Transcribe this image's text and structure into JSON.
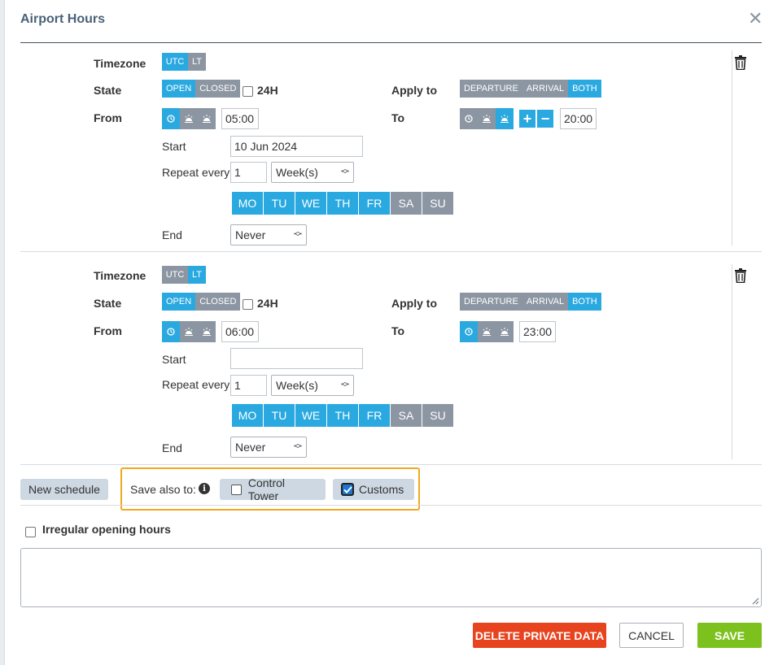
{
  "dialog": {
    "title": "Airport Hours",
    "close_label": "✕"
  },
  "schedules": [
    {
      "timezone_label": "Timezone",
      "tz_options": [
        "UTC",
        "LT"
      ],
      "tz_selected": "UTC",
      "state_label": "State",
      "state_options": [
        "OPEN",
        "CLOSED"
      ],
      "state_selected": "OPEN",
      "h24_label": "24H",
      "apply_label": "Apply to",
      "apply_options": [
        "DEPARTURE",
        "ARRIVAL",
        "BOTH"
      ],
      "apply_selected": "BOTH",
      "from_label": "From",
      "from_time": "05:00",
      "to_label": "To",
      "to_time": "20:00",
      "start_label": "Start",
      "start_value": "10 Jun 2024",
      "repeat_label": "Repeat every",
      "repeat_value": "1",
      "repeat_unit": "Week(s)",
      "days": [
        "MO",
        "TU",
        "WE",
        "TH",
        "FR",
        "SA",
        "SU"
      ],
      "end_label": "End",
      "end_value": "Never"
    },
    {
      "timezone_label": "Timezone",
      "tz_options": [
        "UTC",
        "LT"
      ],
      "tz_selected": "LT",
      "state_label": "State",
      "state_options": [
        "OPEN",
        "CLOSED"
      ],
      "state_selected": "OPEN",
      "h24_label": "24H",
      "apply_label": "Apply to",
      "apply_options": [
        "DEPARTURE",
        "ARRIVAL",
        "BOTH"
      ],
      "apply_selected": "BOTH",
      "from_label": "From",
      "from_time": "06:00",
      "to_label": "To",
      "to_time": "23:00",
      "start_label": "Start",
      "start_value": "",
      "repeat_label": "Repeat every",
      "repeat_value": "1",
      "repeat_unit": "Week(s)",
      "days": [
        "MO",
        "TU",
        "WE",
        "TH",
        "FR",
        "SA",
        "SU"
      ],
      "end_label": "End",
      "end_value": "Never"
    }
  ],
  "footer": {
    "new_schedule": "New schedule",
    "save_also_to": "Save also to:",
    "control_tower": "Control Tower",
    "customs": "Customs",
    "irregular": "Irregular opening hours",
    "delete_private": "DELETE PRIVATE DATA",
    "cancel": "CANCEL",
    "save": "SAVE"
  },
  "colors": {
    "accent": "#2aa9e0",
    "inactive": "#8c96a2",
    "danger": "#e7431f",
    "success": "#7dc11e",
    "highlight": "#f0a920"
  }
}
